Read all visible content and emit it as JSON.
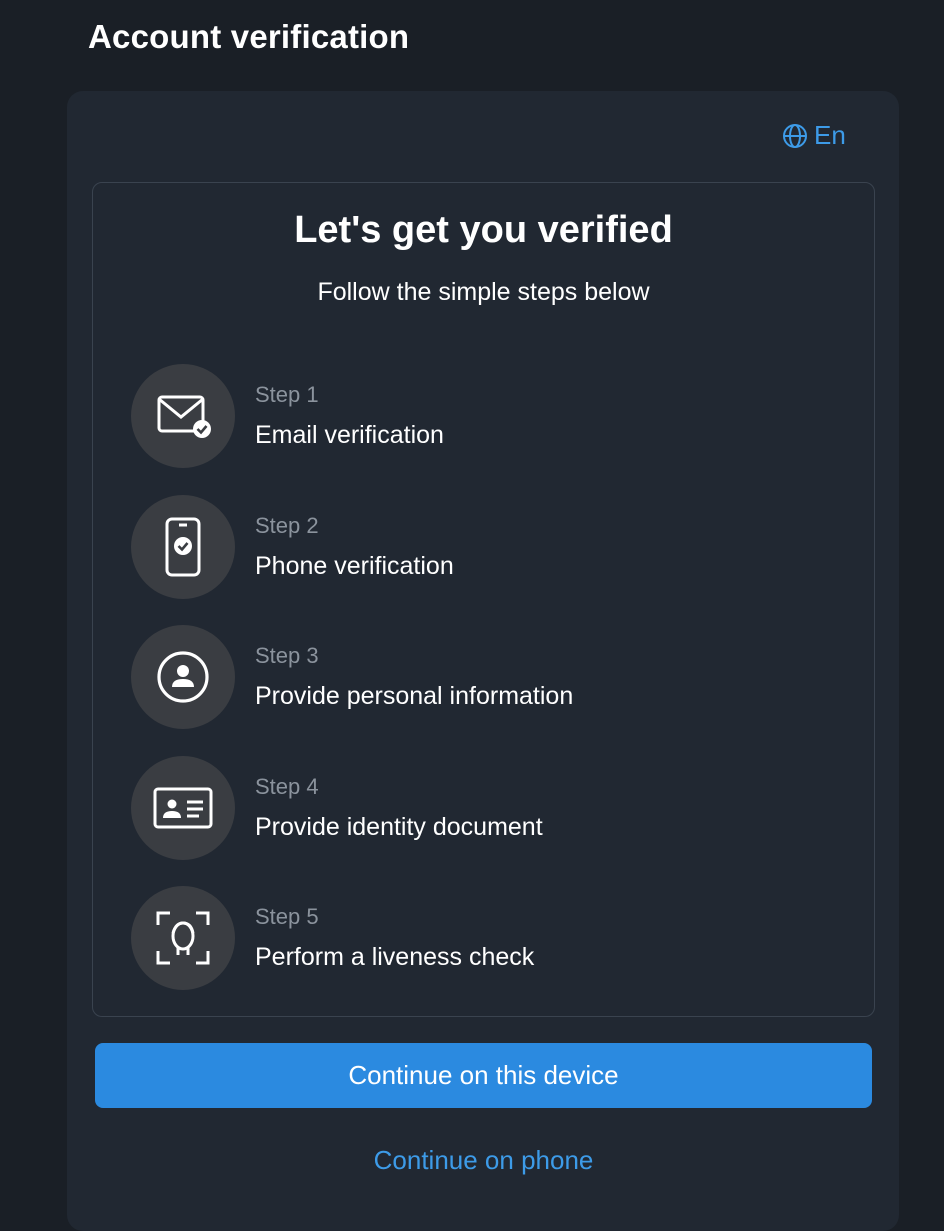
{
  "header": {
    "title": "Account verification"
  },
  "language": {
    "label": "En",
    "icon": "globe-icon",
    "color": "#3d9be8"
  },
  "intro": {
    "heading": "Let's get you verified",
    "subheading": "Follow the simple steps below"
  },
  "steps": [
    {
      "number": "Step 1",
      "title": "Email verification",
      "icon": "email-check-icon"
    },
    {
      "number": "Step 2",
      "title": "Phone verification",
      "icon": "phone-check-icon"
    },
    {
      "number": "Step 3",
      "title": "Provide personal information",
      "icon": "user-circle-icon"
    },
    {
      "number": "Step 4",
      "title": "Provide identity document",
      "icon": "id-card-icon"
    },
    {
      "number": "Step 5",
      "title": "Perform a liveness check",
      "icon": "face-scan-icon"
    }
  ],
  "actions": {
    "primary_label": "Continue on this device",
    "secondary_label": "Continue on phone"
  },
  "colors": {
    "background": "#1a1f26",
    "card": "#212832",
    "accent": "#2b8ae0",
    "link": "#3d9be8"
  }
}
